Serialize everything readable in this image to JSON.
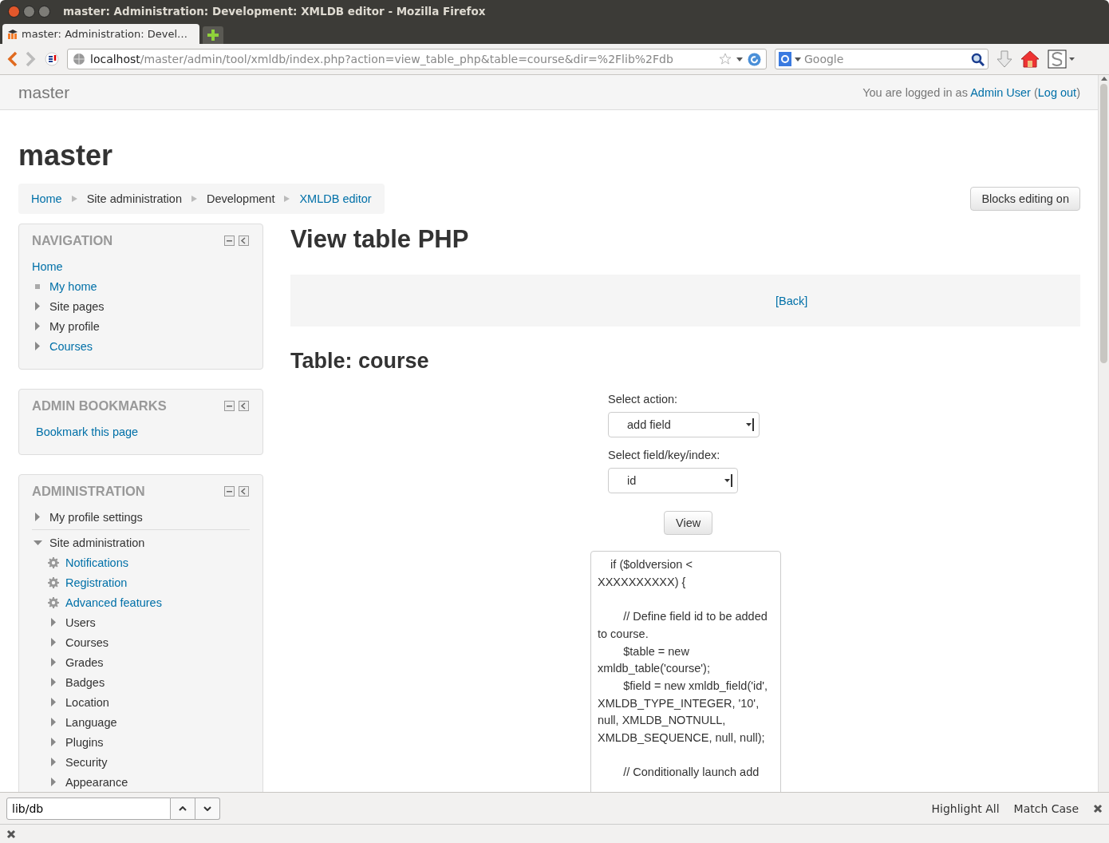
{
  "window": {
    "title": "master: Administration: Development: XMLDB editor - Mozilla Firefox"
  },
  "tabs": [
    {
      "label": "master: Administration: Devel…",
      "selected": true
    }
  ],
  "address_bar": {
    "host": "localhost",
    "path": "/master/admin/tool/xmldb/index.php?action=view_table_php&table=course&dir=%2Flib%2Fdb"
  },
  "search_bar": {
    "placeholder": "Google"
  },
  "header": {
    "site_name": "master",
    "login_prefix": "You are logged in as",
    "user": "Admin User",
    "logout_open": "(",
    "logout": "Log out",
    "logout_close": ")"
  },
  "page_title": "master",
  "breadcrumb": [
    {
      "label": "Home",
      "link": true
    },
    {
      "label": "Site administration",
      "link": false
    },
    {
      "label": "Development",
      "link": false
    },
    {
      "label": "XMLDB editor",
      "link": true
    }
  ],
  "blocks_button": "Blocks editing on",
  "navigation": {
    "title": "NAVIGATION",
    "items": [
      {
        "label": "Home",
        "kind": "none",
        "link": true
      },
      {
        "label": "My home",
        "kind": "bullet",
        "link": true
      },
      {
        "label": "Site pages",
        "kind": "collapsed",
        "link": false
      },
      {
        "label": "My profile",
        "kind": "collapsed",
        "link": false
      },
      {
        "label": "Courses",
        "kind": "collapsed",
        "link": true
      }
    ]
  },
  "admin_bookmarks": {
    "title": "ADMIN BOOKMARKS",
    "link": "Bookmark this page"
  },
  "administration": {
    "title": "ADMINISTRATION",
    "items": [
      {
        "label": "My profile settings",
        "kind": "collapsed",
        "link": false
      },
      {
        "label": "Site administration",
        "kind": "expanded",
        "link": false,
        "children": [
          {
            "label": "Notifications",
            "kind": "gear",
            "link": true
          },
          {
            "label": "Registration",
            "kind": "gear",
            "link": true
          },
          {
            "label": "Advanced features",
            "kind": "gear",
            "link": true
          },
          {
            "label": "Users",
            "kind": "collapsed",
            "link": false
          },
          {
            "label": "Courses",
            "kind": "collapsed",
            "link": false
          },
          {
            "label": "Grades",
            "kind": "collapsed",
            "link": false
          },
          {
            "label": "Badges",
            "kind": "collapsed",
            "link": false
          },
          {
            "label": "Location",
            "kind": "collapsed",
            "link": false
          },
          {
            "label": "Language",
            "kind": "collapsed",
            "link": false
          },
          {
            "label": "Plugins",
            "kind": "collapsed",
            "link": false
          },
          {
            "label": "Security",
            "kind": "collapsed",
            "link": false
          },
          {
            "label": "Appearance",
            "kind": "collapsed",
            "link": false
          }
        ]
      }
    ]
  },
  "main": {
    "heading": "View table PHP",
    "back_link": "[Back]",
    "table_heading": "Table: course",
    "action_label": "Select action:",
    "action_value": "add field",
    "field_label": "Select field/key/index:",
    "field_value": "id",
    "view_button": "View",
    "code": [
      [
        "    if ($oldversion <",
        "XXXXXXXXXX) {"
      ],
      [
        "        // Define field id to be added",
        "to course.",
        "        $table = new",
        "xmldb_table('course');",
        "        $field = new xmldb_field('id',",
        "XMLDB_TYPE_INTEGER, '10',",
        "null, XMLDB_NOTNULL,",
        "XMLDB_SEQUENCE, null, null);"
      ],
      [
        "        // Conditionally launch add"
      ]
    ]
  },
  "find_bar": {
    "value": "lib/db",
    "highlight_all": "Highlight All",
    "match_case": "Match Case"
  }
}
